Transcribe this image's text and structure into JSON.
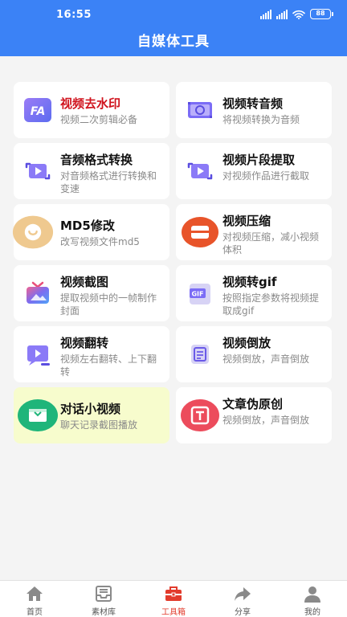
{
  "status": {
    "time": "16:55",
    "battery": "88"
  },
  "header": {
    "title": "自媒体工具"
  },
  "tools": [
    {
      "name": "视频去水印",
      "desc": "视频二次剪辑必备",
      "icon": "watermark-remove-icon"
    },
    {
      "name": "视频转音频",
      "desc": "将视频转换为音频",
      "icon": "video-to-audio-icon"
    },
    {
      "name": "音频格式转换",
      "desc": "对音频格式进行转换和变速",
      "icon": "audio-convert-icon"
    },
    {
      "name": "视频片段提取",
      "desc": "对视频作品进行截取",
      "icon": "clip-extract-icon"
    },
    {
      "name": "MD5修改",
      "desc": "改写视频文件md5",
      "icon": "md5-icon"
    },
    {
      "name": "视频压缩",
      "desc": "对视频压缩，减小视频体积",
      "icon": "compress-icon"
    },
    {
      "name": "视频截图",
      "desc": "提取视频中的一帧制作封面",
      "icon": "screenshot-tv-icon"
    },
    {
      "name": "视频转gif",
      "desc": "按照指定参数将视频提取成gif",
      "icon": "gif-icon"
    },
    {
      "name": "视频翻转",
      "desc": "视频左右翻转、上下翻转",
      "icon": "flip-icon"
    },
    {
      "name": "视频倒放",
      "desc": "视频倒放，声音倒放",
      "icon": "reverse-icon"
    },
    {
      "name": "对话小视频",
      "desc": "聊天记录截图播放",
      "icon": "chat-video-icon"
    },
    {
      "name": "文章伪原创",
      "desc": "视频倒放，声音倒放",
      "icon": "article-icon"
    }
  ],
  "tabs": [
    {
      "label": "首页",
      "icon": "home-icon"
    },
    {
      "label": "素材库",
      "icon": "inbox-icon"
    },
    {
      "label": "工具箱",
      "icon": "toolbox-icon",
      "active": true
    },
    {
      "label": "分享",
      "icon": "share-icon"
    },
    {
      "label": "我的",
      "icon": "user-icon"
    }
  ],
  "colors": {
    "primary": "#3b82f6",
    "active_tab": "#e23b2c",
    "highlight_card": "#f7fccd",
    "first_tool_name": "#d0131d"
  }
}
